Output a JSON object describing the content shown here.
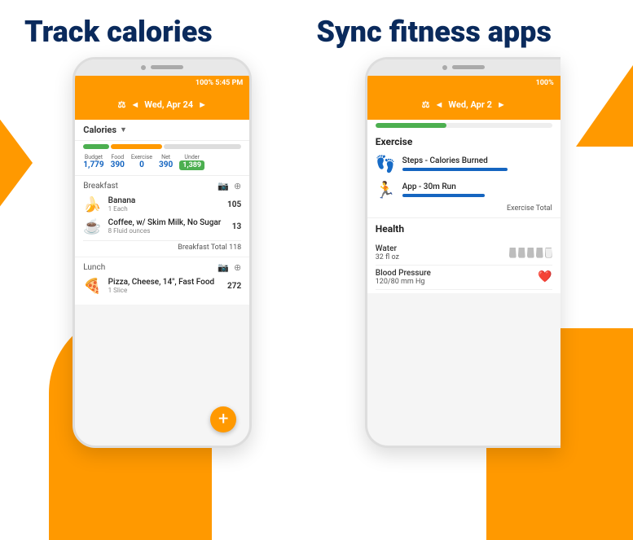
{
  "header": {
    "left_title": "Track calories",
    "right_title": "Sync fitness apps"
  },
  "phone1": {
    "status": "100% 5:45 PM",
    "nav_date": "Wed, Apr 24",
    "calories_label": "Calories",
    "stats": {
      "budget_label": "Budget",
      "budget_value": "1,779",
      "food_label": "Food",
      "food_value": "390",
      "exercise_label": "Exercise",
      "exercise_value": "0",
      "net_label": "Net",
      "net_value": "390",
      "under_label": "Under",
      "under_value": "1,389"
    },
    "breakfast": {
      "title": "Breakfast",
      "items": [
        {
          "name": "Banana",
          "desc": "1 Each",
          "cal": "105",
          "emoji": "🍌"
        },
        {
          "name": "Coffee, w/ Skim Milk, No Sugar",
          "desc": "8 Fluid ounces",
          "cal": "13",
          "emoji": "☕"
        }
      ],
      "total_label": "Breakfast Total",
      "total": "118"
    },
    "lunch": {
      "title": "Lunch",
      "items": [
        {
          "name": "Pizza, Cheese, 14\", Fast Food",
          "desc": "1 Slice",
          "cal": "272",
          "emoji": "🍕"
        }
      ]
    }
  },
  "phone2": {
    "status": "100%",
    "nav_date": "Wed, Apr 2",
    "exercise_section": "Exercise",
    "exercise_items": [
      {
        "name": "Steps - Calories Burned",
        "bar_width": "70%"
      },
      {
        "name": "App - 30m Run",
        "bar_width": "55%"
      }
    ],
    "exercise_total_label": "Exercise Total",
    "health_section": "Health",
    "health_items": [
      {
        "label": "Water",
        "value": "32 fl oz",
        "icon_type": "glasses"
      },
      {
        "label": "Blood Pressure",
        "value": "120/80 mm Hg",
        "icon_type": "heart"
      }
    ]
  },
  "icons": {
    "camera": "⬤",
    "speaker": "▬",
    "arrow_left": "◄",
    "arrow_right": "►",
    "dropdown": "▼",
    "camera_meal": "📷",
    "plus": "+",
    "steps_icon": "👣",
    "run_icon": "🏃"
  }
}
